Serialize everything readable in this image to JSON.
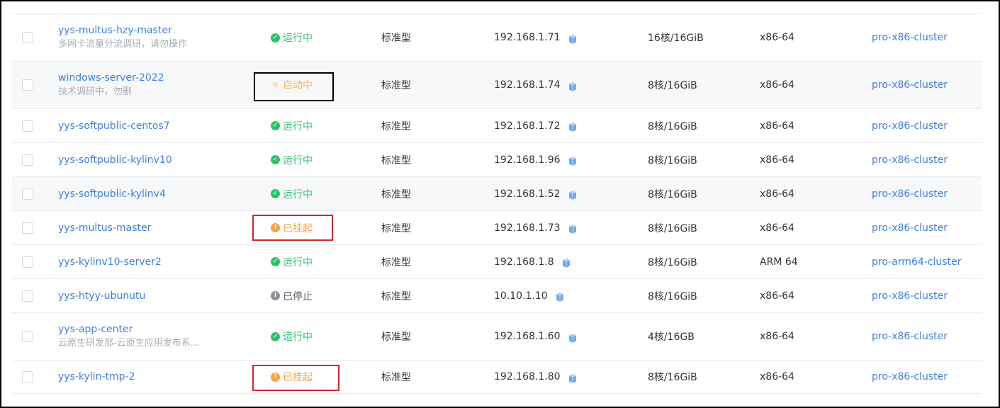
{
  "colors": {
    "link": "#3f7fe0",
    "running": "#2ec36b",
    "starting": "#f5b35b",
    "suspended": "#f5a447",
    "stopped": "#8a8f97",
    "ip_icon": "#5b9be8"
  },
  "table": {
    "rows": [
      {
        "name": "yys-multus-hzy-master",
        "desc": "多网卡流量分流调研，请勿操作",
        "status": "运行中",
        "status_kind": "running",
        "status_icon": "check-circle-icon",
        "type": "标准型",
        "ip": "192.168.1.71",
        "spec": "16核/16GiB",
        "arch": "x86-64",
        "cluster": "pro-x86-cluster"
      },
      {
        "name": "windows-server-2022",
        "desc": "技术调研中，勿删",
        "status": "启动中",
        "status_kind": "starting",
        "status_icon": "sun-icon",
        "type": "标准型",
        "ip": "192.168.1.74",
        "spec": "8核/16GiB",
        "arch": "x86-64",
        "cluster": "pro-x86-cluster"
      },
      {
        "name": "yys-softpublic-centos7",
        "desc": "",
        "status": "运行中",
        "status_kind": "running",
        "status_icon": "check-circle-icon",
        "type": "标准型",
        "ip": "192.168.1.72",
        "spec": "8核/16GiB",
        "arch": "x86-64",
        "cluster": "pro-x86-cluster"
      },
      {
        "name": "yys-softpublic-kylinv10",
        "desc": "",
        "status": "运行中",
        "status_kind": "running",
        "status_icon": "check-circle-icon",
        "type": "标准型",
        "ip": "192.168.1.96",
        "spec": "8核/16GiB",
        "arch": "x86-64",
        "cluster": "pro-x86-cluster"
      },
      {
        "name": "yys-softpublic-kylinv4",
        "desc": "",
        "status": "运行中",
        "status_kind": "running",
        "status_icon": "check-circle-icon",
        "type": "标准型",
        "ip": "192.168.1.52",
        "spec": "8核/16GiB",
        "arch": "x86-64",
        "cluster": "pro-x86-cluster"
      },
      {
        "name": "yys-multus-master",
        "desc": "",
        "status": "已挂起",
        "status_kind": "suspended",
        "status_icon": "exclamation-circle-icon",
        "type": "标准型",
        "ip": "192.168.1.73",
        "spec": "8核/16GiB",
        "arch": "x86-64",
        "cluster": "pro-x86-cluster"
      },
      {
        "name": "yys-kylinv10-server2",
        "desc": "",
        "status": "运行中",
        "status_kind": "running",
        "status_icon": "check-circle-icon",
        "type": "标准型",
        "ip": "192.168.1.8",
        "spec": "8核/16GiB",
        "arch": "ARM 64",
        "cluster": "pro-arm64-cluster"
      },
      {
        "name": "yys-htyy-ubunutu",
        "desc": "",
        "status": "已停止",
        "status_kind": "stopped",
        "status_icon": "info-circle-icon",
        "type": "标准型",
        "ip": "10.10.1.10",
        "spec": "8核/16GiB",
        "arch": "x86-64",
        "cluster": "pro-x86-cluster"
      },
      {
        "name": "yys-app-center",
        "desc": "云原生研发部-云原生应用发布系...",
        "status": "运行中",
        "status_kind": "running",
        "status_icon": "check-circle-icon",
        "type": "标准型",
        "ip": "192.168.1.60",
        "spec": "4核/16GB",
        "arch": "x86-64",
        "cluster": "pro-x86-cluster"
      },
      {
        "name": "yys-kylin-tmp-2",
        "desc": "",
        "status": "已挂起",
        "status_kind": "suspended",
        "status_icon": "exclamation-circle-icon",
        "type": "标准型",
        "ip": "192.168.1.80",
        "spec": "8核/16GiB",
        "arch": "x86-64",
        "cluster": "pro-x86-cluster"
      }
    ]
  }
}
